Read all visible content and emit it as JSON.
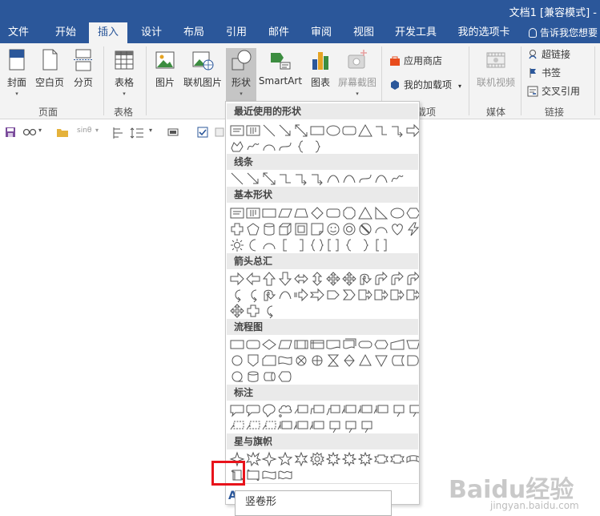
{
  "window": {
    "title": "文档1 [兼容模式] -"
  },
  "tabs": [
    "文件",
    "开始",
    "插入",
    "设计",
    "布局",
    "引用",
    "邮件",
    "审阅",
    "视图",
    "开发工具",
    "我的选项卡"
  ],
  "active_tab": "插入",
  "tell_me": "告诉我您想要",
  "ribbon": {
    "cover": "封面",
    "blank_page": "空白页",
    "page_break": "分页",
    "table": "表格",
    "picture": "图片",
    "online_picture": "联机图片",
    "shapes": "形状",
    "smartart": "SmartArt",
    "chart": "图表",
    "screenshot": "屏幕截图",
    "app_store": "应用商店",
    "my_addins": "我的加载项",
    "online_video": "联机视频",
    "hyperlink": "超链接",
    "bookmark": "书签",
    "cross_reference": "交叉引用",
    "groups": {
      "pages": "页面",
      "tables": "表格",
      "addins": "载项",
      "media": "媒体",
      "links": "链接"
    }
  },
  "quickbar": {
    "formula": "sinθ"
  },
  "shapes_panel": {
    "categories": {
      "recent": "最近使用的形状",
      "lines": "线条",
      "basic": "基本形状",
      "arrows": "箭头总汇",
      "flowchart": "流程图",
      "callouts": "标注",
      "stars": "星与旗帜"
    },
    "partial_letter": "A"
  },
  "tooltip": "竖卷形",
  "watermark": {
    "main": "Baidu经验",
    "sub": "jingyan.baidu.com"
  },
  "colors": {
    "title_bar": "#2b579a",
    "ribbon_bg": "#f3f3f3",
    "category_bg": "#eaeaea",
    "highlight": "#e8131b"
  }
}
